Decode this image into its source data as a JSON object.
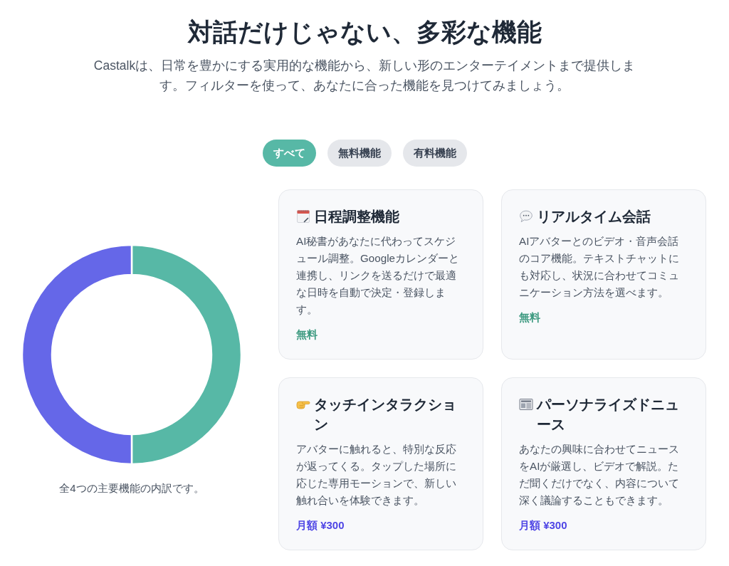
{
  "header": {
    "title": "対話だけじゃない、多彩な機能",
    "subtitle": "Castalkは、日常を豊かにする実用的な機能から、新しい形のエンターテイメントまで提供します。フィルターを使って、あなたに合った機能を見つけてみましょう。"
  },
  "filters": [
    {
      "label": "すべて",
      "selected": true
    },
    {
      "label": "無料機能",
      "selected": false
    },
    {
      "label": "有料機能",
      "selected": false
    }
  ],
  "chart": {
    "caption": "全4つの主要機能の内訳です。"
  },
  "features": [
    {
      "title": "日程調整機能",
      "description": "AI秘書があなたに代わってスケジュール調整。Googleカレンダーと連携し、リンクを送るだけで最適な日時を自動で決定・登録します。",
      "price": "無料",
      "kind": "free"
    },
    {
      "title": "リアルタイム会話",
      "description": "AIアバターとのビデオ・音声会話のコア機能。テキストチャットにも対応し、状況に合わせてコミュニケーション方法を選べます。",
      "price": "無料",
      "kind": "free"
    },
    {
      "title": "タッチインタラクション",
      "description": "アバターに触れると、特別な反応が返ってくる。タップした場所に応じた専用モーションで、新しい触れ合いを体験できます。",
      "price": "月額 ¥300",
      "kind": "paid"
    },
    {
      "title": "パーソナライズドニュース",
      "description": "あなたの興味に合わせてニュースをAIが厳選し、ビデオで解説。ただ聞くだけでなく、内容について深く議論することもできます。",
      "price": "月額 ¥300",
      "kind": "paid"
    }
  ]
}
